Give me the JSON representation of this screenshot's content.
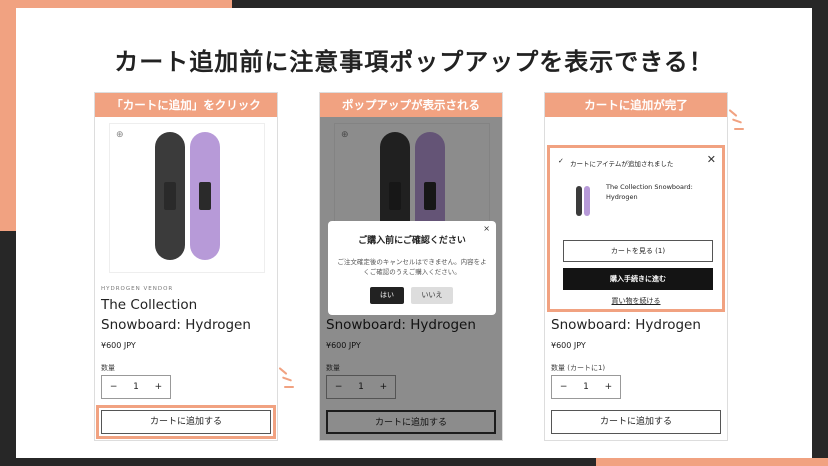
{
  "title": "カート追加前に注意事項ポップアップを表示できる！",
  "accent": "#f1a281",
  "panels": [
    {
      "tag": "「カートに追加」をクリック",
      "vendor": "HYDROGEN VENDOR",
      "product_title": "The Collection Snowboard: Hydrogen",
      "price": "¥600 JPY",
      "qty_label": "数量",
      "qty_value": "1",
      "add_to_cart": "カートに追加する"
    },
    {
      "tag": "ポップアップが表示される",
      "product_title": "Snowboard: Hydrogen",
      "price": "¥600 JPY",
      "qty_label": "数量",
      "qty_value": "1",
      "add_to_cart": "カートに追加する",
      "modal": {
        "title": "ご購入前にご確認ください",
        "body": "ご注文確定後のキャンセルはできません。内容をよくご確認のうえご購入ください。",
        "yes": "はい",
        "no": "いいえ",
        "close": "×"
      }
    },
    {
      "tag": "カートに追加が完了",
      "product_title": "Snowboard: Hydrogen",
      "price": "¥600 JPY",
      "qty_label": "数量 (カートに1)",
      "qty_value": "1",
      "add_to_cart": "カートに追加する",
      "cart": {
        "message": "カートにアイテムが追加されました",
        "item_name": "The Collection Snowboard: Hydrogen",
        "view_cart": "カートを見る (1)",
        "checkout": "購入手続きに進む",
        "continue": "買い物を続ける"
      }
    }
  ],
  "icons": {
    "zoom": "zoom-icon",
    "close": "close-icon",
    "check": "check-icon",
    "minus": "minus-icon",
    "plus": "plus-icon"
  }
}
